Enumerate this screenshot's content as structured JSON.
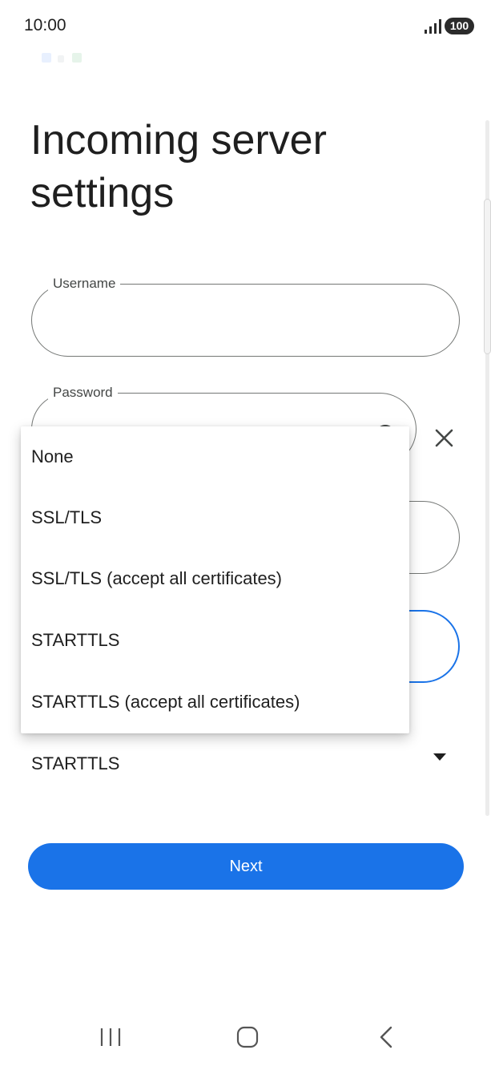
{
  "status_bar": {
    "time": "10:00",
    "battery": "100",
    "signal_icon": "signal-bars-icon"
  },
  "page": {
    "title": "Incoming server settings"
  },
  "fields": {
    "username": {
      "label": "Username",
      "value": ""
    },
    "password": {
      "label": "Password",
      "value": ""
    },
    "server": {
      "label": "",
      "value": ""
    },
    "port": {
      "label": "",
      "value": ""
    }
  },
  "security": {
    "selected": "STARTTLS",
    "options": [
      "None",
      "SSL/TLS",
      "SSL/TLS (accept all certificates)",
      "STARTTLS",
      "STARTTLS (accept all certificates)"
    ]
  },
  "buttons": {
    "next_label": "Next"
  },
  "icons": {
    "password_toggle": "eye-icon",
    "clear": "close-icon",
    "dropdown": "arrow-drop-down-icon",
    "nav_recents": "recents-icon",
    "nav_home": "home-icon",
    "nav_back": "back-icon"
  },
  "colors": {
    "accent": "#1a73e8",
    "outline": "#747775",
    "text": "#1f1f1f"
  }
}
